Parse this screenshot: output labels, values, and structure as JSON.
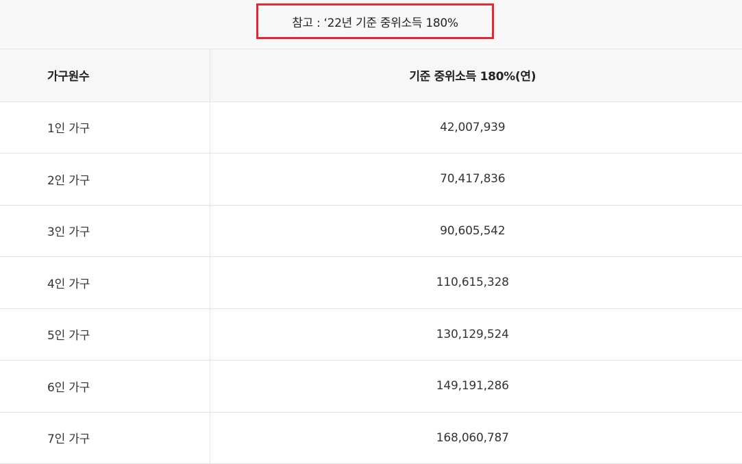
{
  "caption": "참고 : ‘22년 기준 중위소득 180%",
  "table": {
    "headers": [
      "가구원수",
      "기준 중위소득 180%(연)"
    ],
    "rows": [
      {
        "household": "1인 가구",
        "income": "42,007,939"
      },
      {
        "household": "2인 가구",
        "income": "70,417,836"
      },
      {
        "household": "3인 가구",
        "income": "90,605,542"
      },
      {
        "household": "4인 가구",
        "income": "110,615,328"
      },
      {
        "household": "5인 가구",
        "income": "130,129,524"
      },
      {
        "household": "6인 가구",
        "income": "149,191,286"
      },
      {
        "household": "7인 가구",
        "income": "168,060,787"
      }
    ]
  },
  "colors": {
    "highlight_border": "#e5262e",
    "header_background": "#f7f7f7",
    "divider": "#e2e2e2"
  }
}
